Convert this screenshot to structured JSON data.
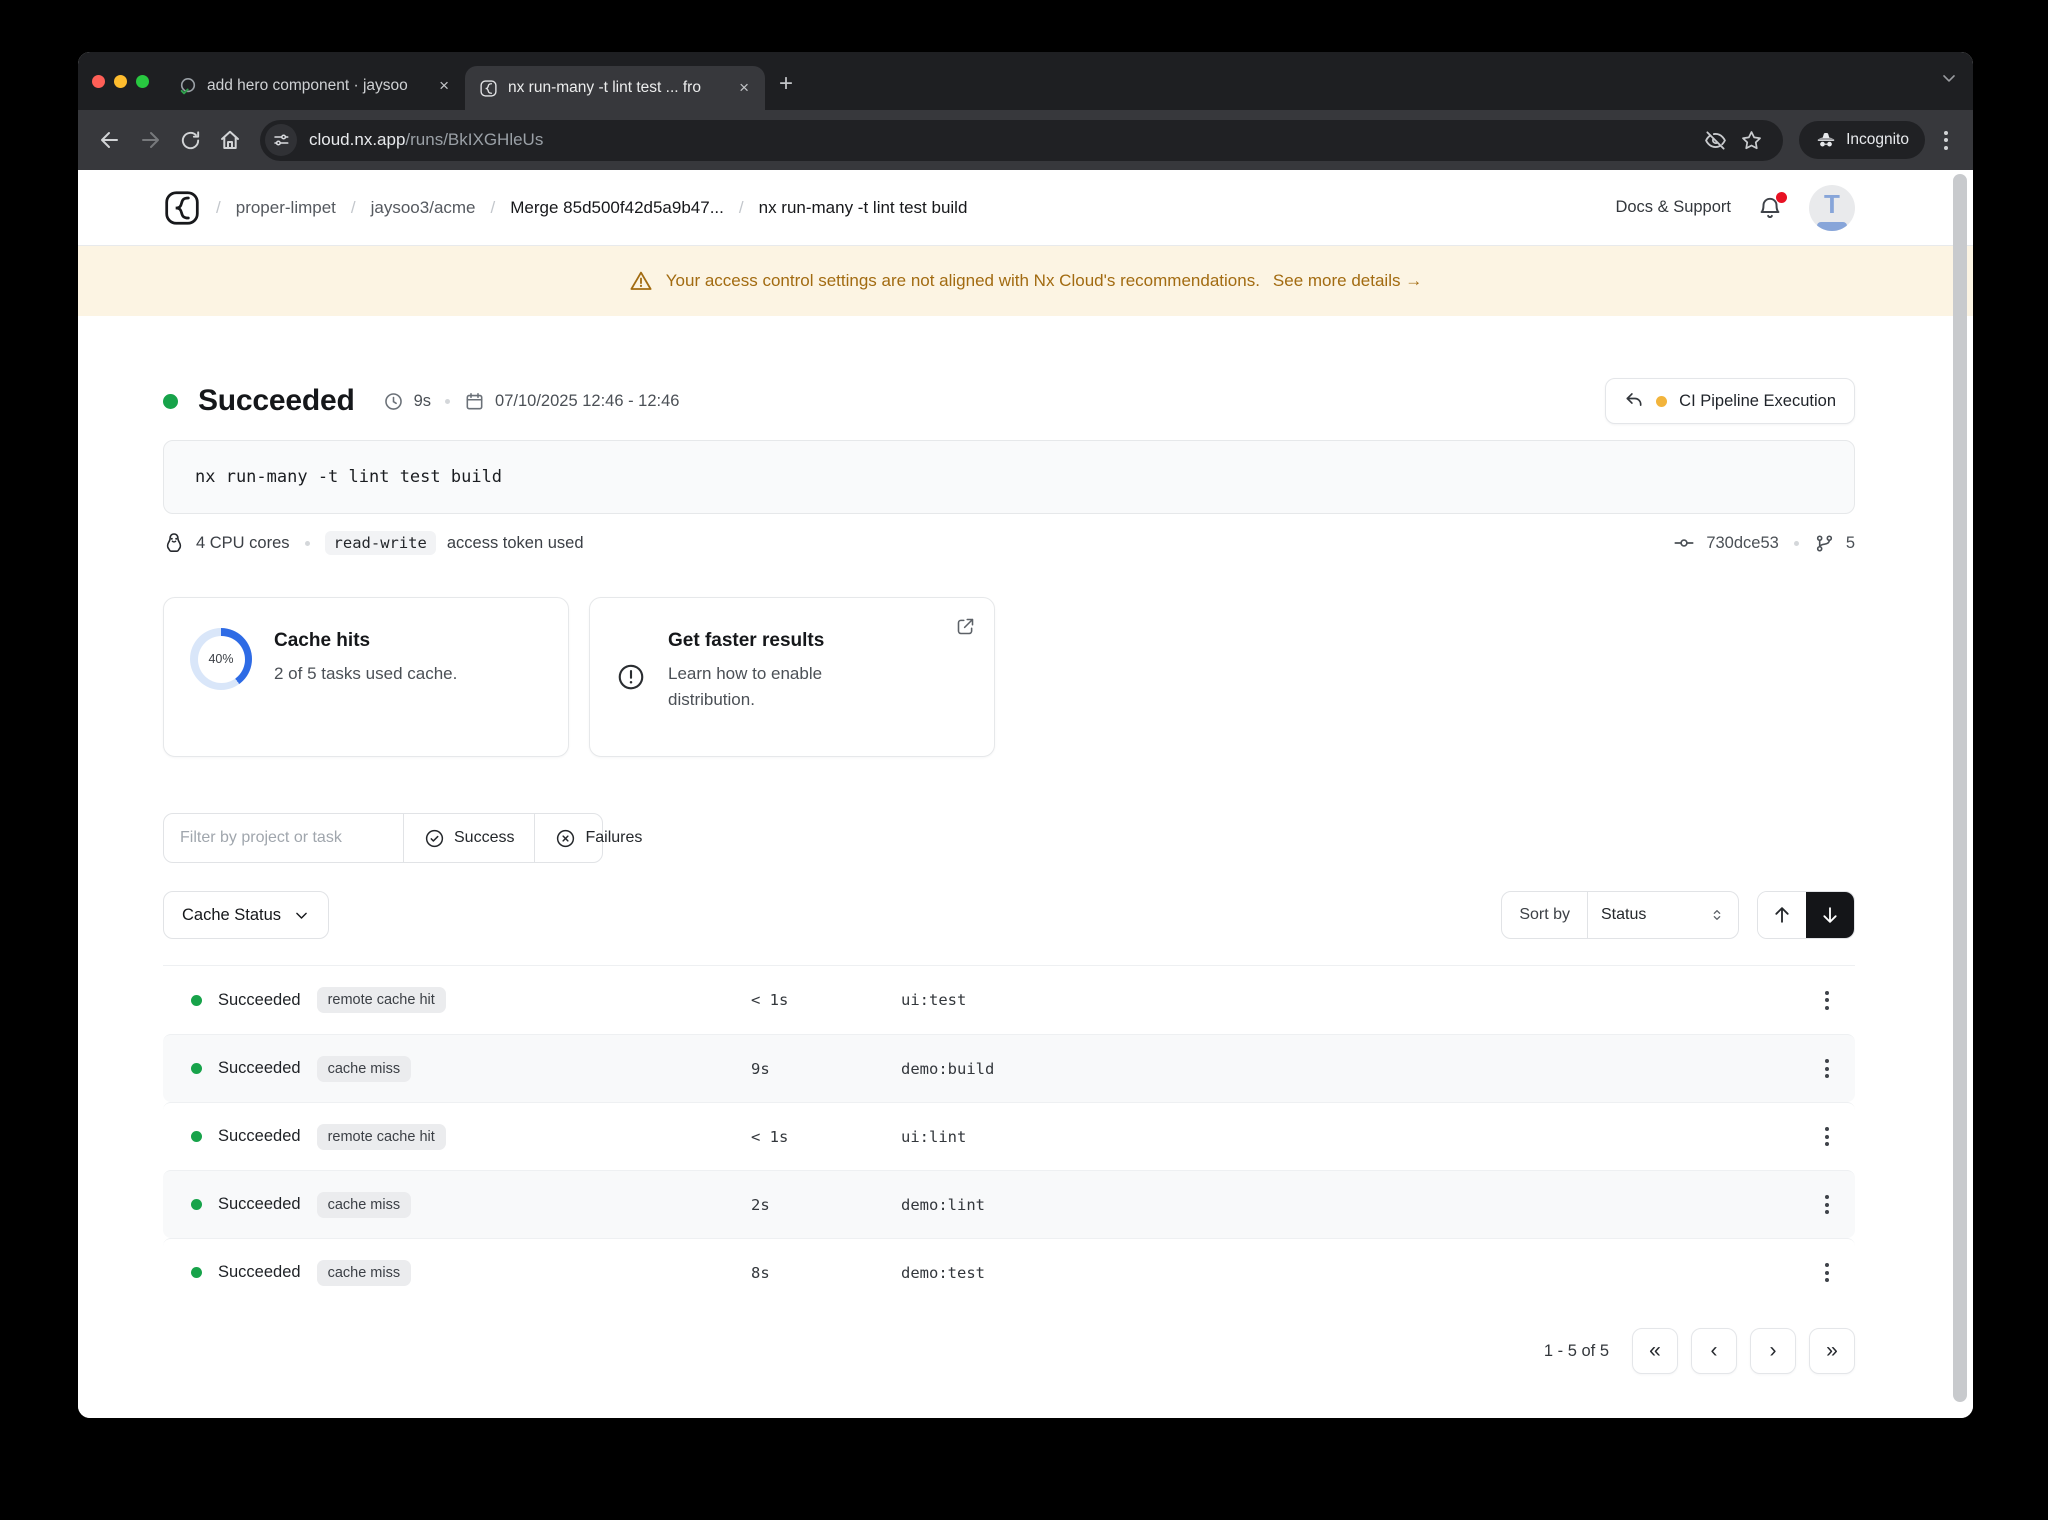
{
  "browser": {
    "tabs": [
      {
        "title": "add hero component · jaysoo",
        "close": "×"
      },
      {
        "title": "nx run-many -t lint test ... fro",
        "close": "×"
      }
    ],
    "new_tab": "+",
    "url_host": "cloud.nx.app",
    "url_path": "/runs/BkIXGHleUs",
    "incognito_label": "Incognito"
  },
  "header": {
    "separator": "/",
    "breadcrumbs": [
      "proper-limpet",
      "jaysoo3/acme",
      "Merge 85d500f42d5a9b47...",
      "nx run-many -t lint test build"
    ],
    "docs_label": "Docs & Support",
    "avatar_letter": "T"
  },
  "banner": {
    "message": "Your access control settings are not aligned with Nx Cloud's recommendations.",
    "link": "See more details →"
  },
  "run": {
    "status": "Succeeded",
    "duration": "9s",
    "date_range": "07/10/2025 12:46 - 12:46",
    "pipeline_label": "CI Pipeline Execution",
    "command": "nx run-many -t lint test build",
    "cpu": "4 CPU cores",
    "token": "read-write",
    "token_note": "access token used",
    "commit": "730dce53",
    "branch_count": "5"
  },
  "cards": {
    "cache": {
      "percent": "40%",
      "title": "Cache hits",
      "subtitle": "2 of 5 tasks used cache."
    },
    "faster": {
      "title": "Get faster results",
      "body": "Learn how to enable distribution."
    }
  },
  "filters": {
    "placeholder": "Filter by project or task",
    "success": "Success",
    "failures": "Failures"
  },
  "controls": {
    "cache_status": "Cache Status",
    "sort_by": "Sort by",
    "sort_value": "Status"
  },
  "table": {
    "rows": [
      {
        "status": "Succeeded",
        "badge": "remote cache hit",
        "duration": "< 1s",
        "task": "ui:test"
      },
      {
        "status": "Succeeded",
        "badge": "cache miss",
        "duration": "9s",
        "task": "demo:build"
      },
      {
        "status": "Succeeded",
        "badge": "remote cache hit",
        "duration": "< 1s",
        "task": "ui:lint"
      },
      {
        "status": "Succeeded",
        "badge": "cache miss",
        "duration": "2s",
        "task": "demo:lint"
      },
      {
        "status": "Succeeded",
        "badge": "cache miss",
        "duration": "8s",
        "task": "demo:test"
      }
    ]
  },
  "pagination": {
    "range": "1 - 5 of 5",
    "first": "«",
    "prev": "‹",
    "next": "›",
    "last": "»"
  },
  "colors": {
    "success_green": "#17a34a",
    "accent_blue": "#2e6be5",
    "donut_track": "#d9e6f9",
    "warning_text": "#a26b11",
    "warning_bg": "#fcf4e3",
    "pipeline_dot_amber": "#f2b43c",
    "notification_red": "#e81123"
  }
}
